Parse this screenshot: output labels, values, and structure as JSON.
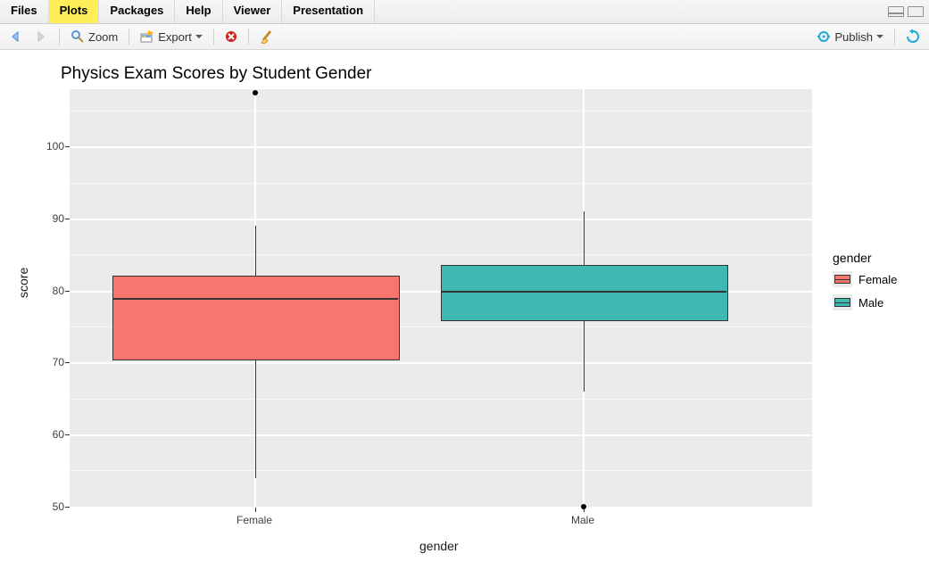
{
  "tabs": {
    "files": "Files",
    "plots": "Plots",
    "packages": "Packages",
    "help": "Help",
    "viewer": "Viewer",
    "presentation": "Presentation"
  },
  "toolbar": {
    "zoom": "Zoom",
    "export": "Export",
    "publish": "Publish"
  },
  "chart_data": {
    "type": "boxplot",
    "title": "Physics Exam Scores by Student Gender",
    "xlabel": "gender",
    "ylabel": "score",
    "ylim": [
      50,
      108
    ],
    "y_ticks": [
      50,
      60,
      70,
      80,
      90,
      100
    ],
    "categories": [
      "Female",
      "Male"
    ],
    "series": [
      {
        "name": "Female",
        "color": "#f8766d",
        "min": 54,
        "q1": 70.5,
        "median": 79,
        "q3": 82,
        "max": 89,
        "outliers": [
          107.5
        ]
      },
      {
        "name": "Male",
        "color": "#3eb8b3",
        "min": 66,
        "q1": 76,
        "median": 80,
        "q3": 83.5,
        "max": 91,
        "outliers": [
          50
        ]
      }
    ],
    "legend": {
      "title": "gender",
      "entries": [
        "Female",
        "Male"
      ]
    }
  }
}
